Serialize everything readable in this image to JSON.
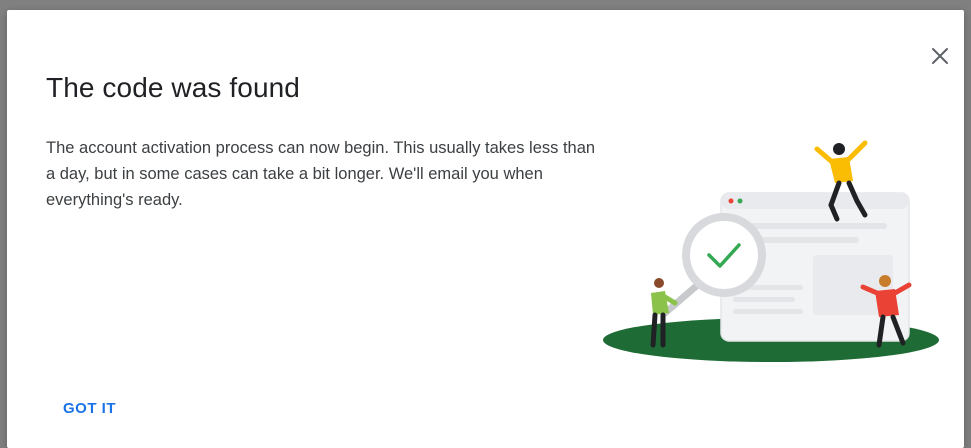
{
  "dialog": {
    "title": "The code was found",
    "body": "The account activation process can now begin. This usually takes less than a day, but in some cases can take a bit longer. We'll email you when everything's ready.",
    "action_label": "GOT IT",
    "close_icon": "close-icon",
    "illustration_icon": "magnifier-checkmark-illustration"
  },
  "colors": {
    "accent": "#1a73e8",
    "ground": "#1e6b35",
    "check": "#34a853"
  }
}
